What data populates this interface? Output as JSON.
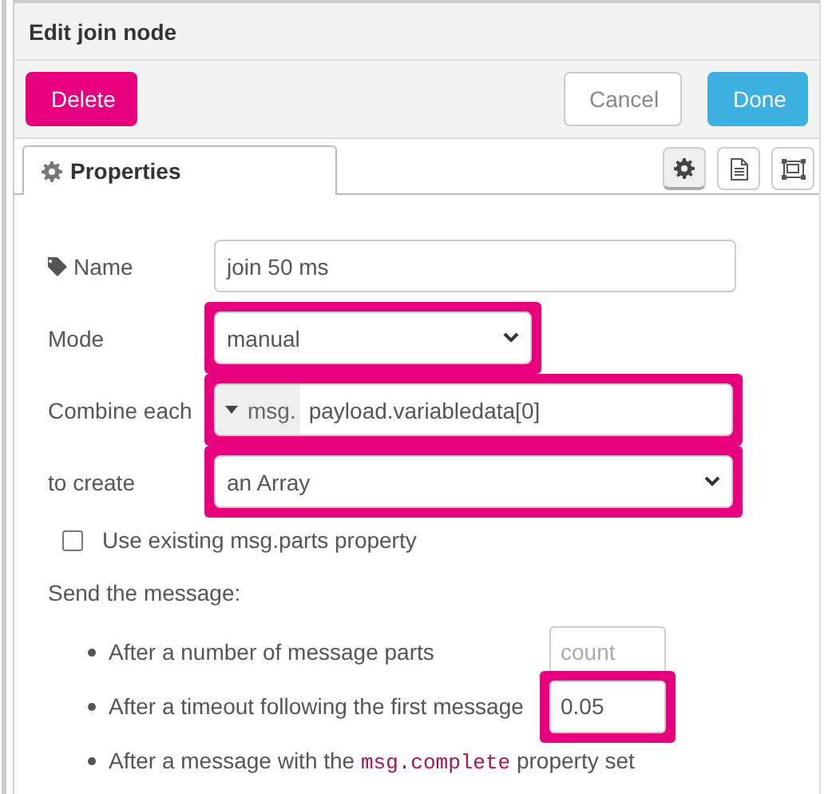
{
  "dialog": {
    "title": "Edit join node"
  },
  "buttons": [
    {
      "label": "Delete",
      "kind": "danger"
    },
    {
      "label": "Cancel",
      "kind": "plain"
    },
    {
      "label": "Done",
      "kind": "primary"
    }
  ],
  "tabs": [
    {
      "label": "Properties",
      "selected": true
    }
  ],
  "tool_tabs": [
    {
      "kind": "gear",
      "selected": true
    },
    {
      "kind": "doc",
      "selected": false
    },
    {
      "kind": "frame",
      "selected": false
    }
  ],
  "fields": [
    {
      "label": "Name",
      "kind": "text",
      "value": "join 50 ms",
      "highlighted": false
    },
    {
      "label": "Mode",
      "kind": "select",
      "value": "manual",
      "highlighted": true
    },
    {
      "label": "Combine each",
      "kind": "typed",
      "prefix": "msg.",
      "value": "payload.variabledata[0]",
      "highlighted": true
    },
    {
      "label": "to create",
      "kind": "select",
      "value": "an Array",
      "highlighted": true
    }
  ],
  "use_parts": {
    "label": "Use existing msg.parts property",
    "checked": false
  },
  "send_heading": "Send the message:",
  "send_options": [
    {
      "text": "After a number of message parts",
      "input": {
        "placeholder": "count",
        "highlighted": false
      }
    },
    {
      "text": "After a timeout following the first message",
      "input": {
        "value": "0.05",
        "highlighted": true
      }
    },
    {
      "text": "After a message with the",
      "code": "msg.complete",
      "text_after": "property set"
    }
  ]
}
